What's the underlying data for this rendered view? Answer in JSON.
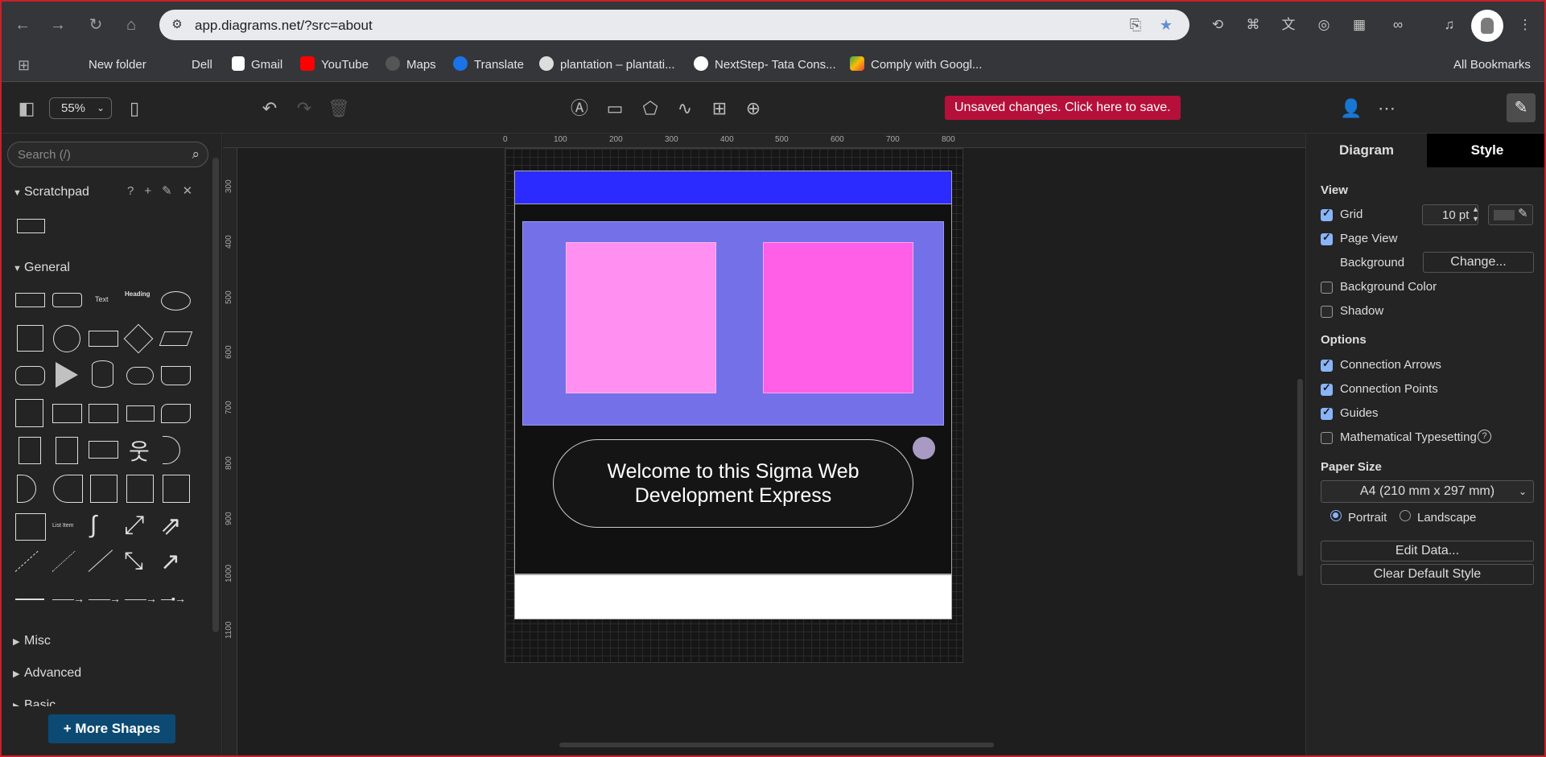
{
  "browser": {
    "url": "app.diagrams.net/?src=about",
    "bookmarks": [
      "New folder",
      "Dell",
      "Gmail",
      "YouTube",
      "Maps",
      "Translate",
      "plantation – plantati...",
      "NextStep- Tata Cons...",
      "Comply with Googl..."
    ],
    "all_bookmarks": "All Bookmarks"
  },
  "toolbar": {
    "zoom": "55%",
    "unsaved": "Unsaved changes. Click here to save."
  },
  "sidebar": {
    "search_placeholder": "Search (/)",
    "scratchpad": "Scratchpad",
    "general": "General",
    "misc": "Misc",
    "advanced": "Advanced",
    "basic_partial": "Basic",
    "more_shapes": "+ More Shapes",
    "shape_text_label": "Text",
    "shape_heading_label": "Heading",
    "shape_list_label": "List Item"
  },
  "ruler": {
    "top": [
      "0",
      "100",
      "200",
      "300",
      "400",
      "500",
      "600",
      "700",
      "800"
    ],
    "left": [
      "300",
      "400",
      "500",
      "600",
      "700",
      "800",
      "900",
      "1000",
      "1100"
    ]
  },
  "canvas": {
    "welcome_text": "Welcome to this Sigma Web Development Express",
    "colors": {
      "blue_bar": "#2b2bff",
      "purple": "#7470e8",
      "pink_light": "#ff8ff0",
      "pink_dark": "#ff5fe6"
    }
  },
  "panel": {
    "tab_diagram": "Diagram",
    "tab_style": "Style",
    "view": "View",
    "grid": "Grid",
    "grid_size": "10 pt",
    "page_view": "Page View",
    "background": "Background",
    "change": "Change...",
    "background_color": "Background Color",
    "shadow": "Shadow",
    "options": "Options",
    "connection_arrows": "Connection Arrows",
    "connection_points": "Connection Points",
    "guides": "Guides",
    "math": "Mathematical Typesetting",
    "paper_size": "Paper Size",
    "paper_value": "A4 (210 mm x 297 mm)",
    "portrait": "Portrait",
    "landscape": "Landscape",
    "edit_data": "Edit Data...",
    "clear_default": "Clear Default Style"
  }
}
